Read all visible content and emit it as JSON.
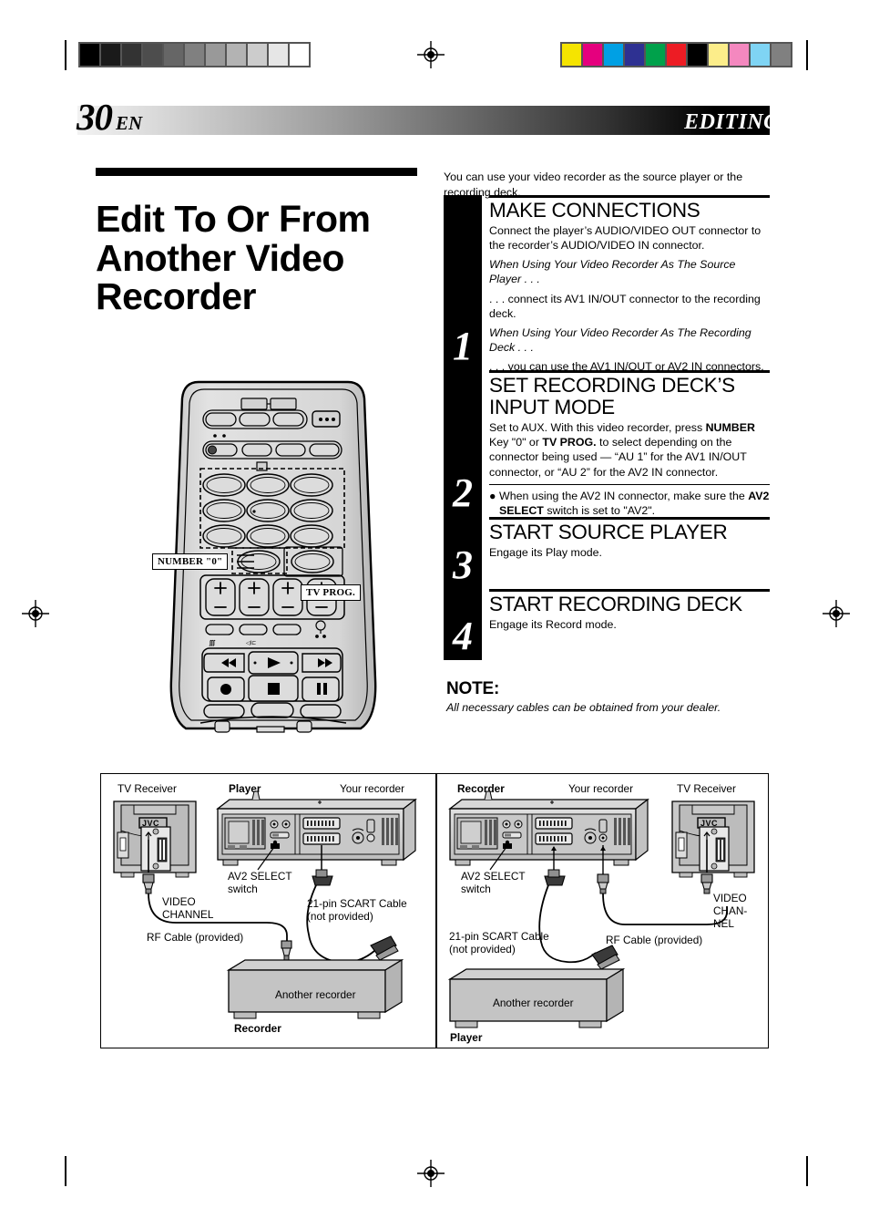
{
  "calibration": {
    "gray_steps": [
      "#000000",
      "#1a1a1a",
      "#333333",
      "#4d4d4d",
      "#666666",
      "#808080",
      "#999999",
      "#b3b3b3",
      "#cccccc",
      "#e6e6e6",
      "#ffffff"
    ],
    "color_bars": [
      "#f5e400",
      "#e5007e",
      "#00a0e4",
      "#2e3192",
      "#00a14b",
      "#ed1c24",
      "#000000",
      "#fced8a",
      "#f488bf",
      "#7fd4f4",
      "#808080"
    ],
    "registration_marks": 4
  },
  "header": {
    "page_number": "30",
    "language_code": "EN",
    "section_title": "EDITING"
  },
  "article": {
    "title": "Edit To Or From Another Video Recorder",
    "intro": "You can use your video recorder as the source player or the recording deck."
  },
  "steps": [
    {
      "number": "1",
      "heading": "MAKE CONNECTIONS",
      "paragraphs": [
        {
          "style": "normal",
          "text": "Connect the player’s AUDIO/VIDEO OUT connector to the recorder’s AUDIO/VIDEO IN connector."
        },
        {
          "style": "italic",
          "text": "When Using Your Video Recorder As The Source Player . . ."
        },
        {
          "style": "normal",
          "text": ". . . connect its AV1 IN/OUT connector to the recording deck."
        },
        {
          "style": "italic",
          "text": "When Using Your Video Recorder As The Recording Deck . . ."
        },
        {
          "style": "normal",
          "text": " . . . you can use the AV1 IN/OUT or AV2 IN connectors."
        }
      ],
      "bullets": []
    },
    {
      "number": "2",
      "heading": "SET RECORDING DECK’S INPUT MODE",
      "paragraphs": [
        {
          "style": "rich",
          "html": "Set to AUX. With this video recorder, press <b>NUMBER</b> Key \"0\" or <b>TV PROG.</b> to select depending on the connector being used — “AU 1” for the AV1 IN/OUT connector, or “AU 2” for the AV2 IN connector."
        }
      ],
      "bullets": [
        {
          "marker": "●",
          "html": "When using the AV2 IN connector, make sure the <b>AV2 SELECT</b> switch is set to \"AV2\"."
        }
      ]
    },
    {
      "number": "3",
      "heading": "START SOURCE PLAYER",
      "paragraphs": [
        {
          "style": "normal",
          "text": "Engage its Play mode."
        }
      ],
      "bullets": []
    },
    {
      "number": "4",
      "heading": "START RECORDING DECK",
      "paragraphs": [
        {
          "style": "normal",
          "text": "Engage its Record mode."
        }
      ],
      "bullets": []
    }
  ],
  "note": {
    "title": "NOTE:",
    "text": "All necessary cables can be obtained from your dealer."
  },
  "remote": {
    "callout_number_key": "NUMBER \"0\"",
    "callout_tv_prog": "TV PROG."
  },
  "diagram": {
    "left_panel": {
      "tv_label": "TV Receiver",
      "tv_brand": "JVC",
      "player_label": "Player",
      "your_recorder_label": "Your recorder",
      "av2_switch_label": "AV2 SELECT switch",
      "video_channel_label": "VIDEO CHANNEL",
      "rf_cable_label": "RF Cable (provided)",
      "scart_cable_label": "21-pin SCART Cable (not provided)",
      "another_recorder_label": "Another recorder",
      "another_recorder_role": "Recorder"
    },
    "right_panel": {
      "recorder_label": "Recorder",
      "your_recorder_label": "Your recorder",
      "tv_label": "TV Receiver",
      "tv_brand": "JVC",
      "av2_switch_label": "AV2 SELECT switch",
      "video_channel_label": "VIDEO CHAN- NEL",
      "rf_cable_label": "RF Cable (provided)",
      "scart_cable_label": "21-pin SCART Cable (not provided)",
      "another_recorder_label": "Another recorder",
      "another_recorder_role": "Player"
    }
  }
}
